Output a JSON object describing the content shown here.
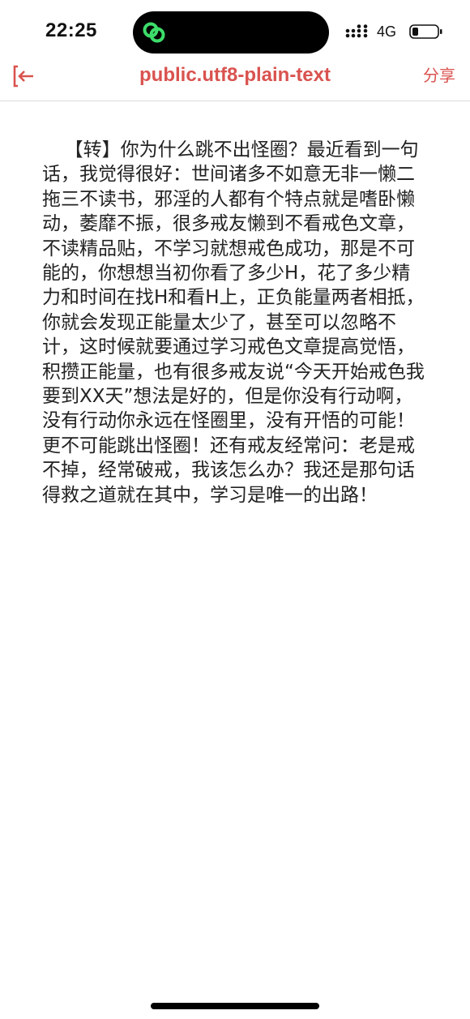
{
  "status_bar": {
    "time": "22:25",
    "network": "4G"
  },
  "nav": {
    "title": "public.utf8-plain-text",
    "share_label": "分享"
  },
  "content": {
    "text": "【转】你为什么跳不出怪圈？最近看到一句话，我觉得很好：世间诸多不如意无非一懒二拖三不读书，邪淫的人都有个特点就是嗜卧懒动，萎靡不振，很多戒友懒到不看戒色文章，不读精品贴，不学习就想戒色成功，那是不可能的，你想想当初你看了多少H，花了多少精力和时间在找H和看H上，正负能量两者相抵，你就会发现正能量太少了，甚至可以忽略不计，这时候就要通过学习戒色文章提高觉悟，积攒正能量，也有很多戒友说“今天开始戒色我要到XX天”想法是好的，但是你没有行动啊，没有行动你永远在怪圈里，没有开悟的可能！更不可能跳出怪圈！还有戒友经常问：老是戒不掉，经常破戒，我该怎么办？我还是那句话得救之道就在其中，学习是唯一的出路！"
  },
  "colors": {
    "accent": "#d9534f",
    "island_icon": "#3ddc6a"
  },
  "icons": {
    "back": "exit-arrow-icon",
    "island": "link-rings-icon",
    "signal": "signal-dots-icon",
    "battery": "battery-low-icon"
  }
}
